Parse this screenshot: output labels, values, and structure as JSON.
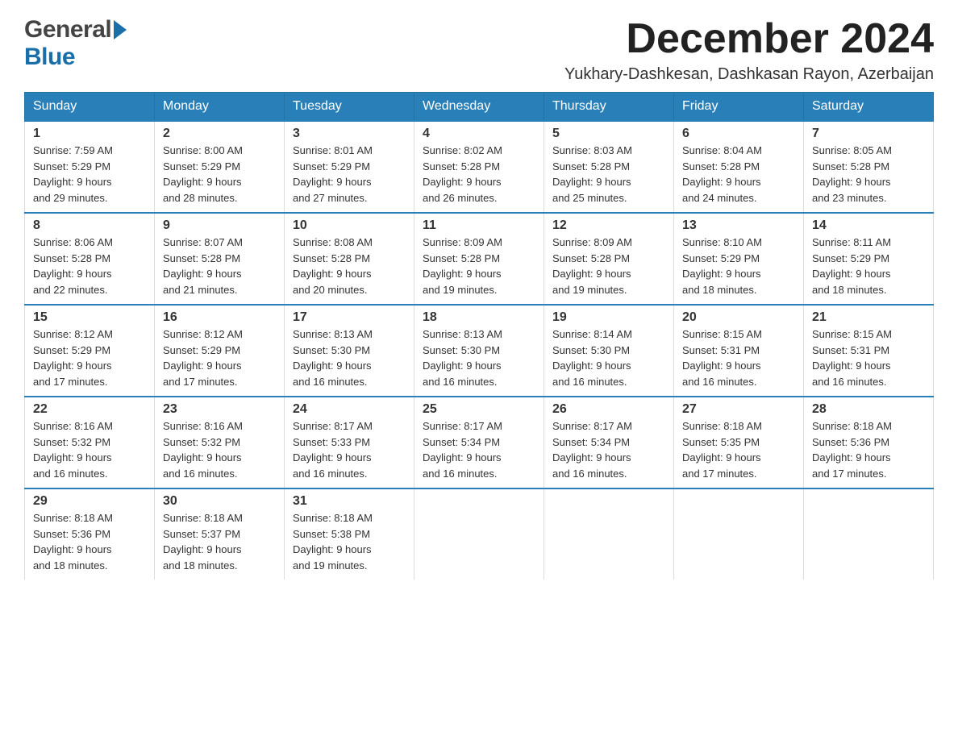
{
  "header": {
    "logo_general": "General",
    "logo_blue": "Blue",
    "month_title": "December 2024",
    "location": "Yukhary-Dashkesan, Dashkasan Rayon, Azerbaijan"
  },
  "weekdays": [
    "Sunday",
    "Monday",
    "Tuesday",
    "Wednesday",
    "Thursday",
    "Friday",
    "Saturday"
  ],
  "weeks": [
    [
      {
        "day": "1",
        "sunrise": "7:59 AM",
        "sunset": "5:29 PM",
        "daylight": "9 hours and 29 minutes."
      },
      {
        "day": "2",
        "sunrise": "8:00 AM",
        "sunset": "5:29 PM",
        "daylight": "9 hours and 28 minutes."
      },
      {
        "day": "3",
        "sunrise": "8:01 AM",
        "sunset": "5:29 PM",
        "daylight": "9 hours and 27 minutes."
      },
      {
        "day": "4",
        "sunrise": "8:02 AM",
        "sunset": "5:28 PM",
        "daylight": "9 hours and 26 minutes."
      },
      {
        "day": "5",
        "sunrise": "8:03 AM",
        "sunset": "5:28 PM",
        "daylight": "9 hours and 25 minutes."
      },
      {
        "day": "6",
        "sunrise": "8:04 AM",
        "sunset": "5:28 PM",
        "daylight": "9 hours and 24 minutes."
      },
      {
        "day": "7",
        "sunrise": "8:05 AM",
        "sunset": "5:28 PM",
        "daylight": "9 hours and 23 minutes."
      }
    ],
    [
      {
        "day": "8",
        "sunrise": "8:06 AM",
        "sunset": "5:28 PM",
        "daylight": "9 hours and 22 minutes."
      },
      {
        "day": "9",
        "sunrise": "8:07 AM",
        "sunset": "5:28 PM",
        "daylight": "9 hours and 21 minutes."
      },
      {
        "day": "10",
        "sunrise": "8:08 AM",
        "sunset": "5:28 PM",
        "daylight": "9 hours and 20 minutes."
      },
      {
        "day": "11",
        "sunrise": "8:09 AM",
        "sunset": "5:28 PM",
        "daylight": "9 hours and 19 minutes."
      },
      {
        "day": "12",
        "sunrise": "8:09 AM",
        "sunset": "5:28 PM",
        "daylight": "9 hours and 19 minutes."
      },
      {
        "day": "13",
        "sunrise": "8:10 AM",
        "sunset": "5:29 PM",
        "daylight": "9 hours and 18 minutes."
      },
      {
        "day": "14",
        "sunrise": "8:11 AM",
        "sunset": "5:29 PM",
        "daylight": "9 hours and 18 minutes."
      }
    ],
    [
      {
        "day": "15",
        "sunrise": "8:12 AM",
        "sunset": "5:29 PM",
        "daylight": "9 hours and 17 minutes."
      },
      {
        "day": "16",
        "sunrise": "8:12 AM",
        "sunset": "5:29 PM",
        "daylight": "9 hours and 17 minutes."
      },
      {
        "day": "17",
        "sunrise": "8:13 AM",
        "sunset": "5:30 PM",
        "daylight": "9 hours and 16 minutes."
      },
      {
        "day": "18",
        "sunrise": "8:13 AM",
        "sunset": "5:30 PM",
        "daylight": "9 hours and 16 minutes."
      },
      {
        "day": "19",
        "sunrise": "8:14 AM",
        "sunset": "5:30 PM",
        "daylight": "9 hours and 16 minutes."
      },
      {
        "day": "20",
        "sunrise": "8:15 AM",
        "sunset": "5:31 PM",
        "daylight": "9 hours and 16 minutes."
      },
      {
        "day": "21",
        "sunrise": "8:15 AM",
        "sunset": "5:31 PM",
        "daylight": "9 hours and 16 minutes."
      }
    ],
    [
      {
        "day": "22",
        "sunrise": "8:16 AM",
        "sunset": "5:32 PM",
        "daylight": "9 hours and 16 minutes."
      },
      {
        "day": "23",
        "sunrise": "8:16 AM",
        "sunset": "5:32 PM",
        "daylight": "9 hours and 16 minutes."
      },
      {
        "day": "24",
        "sunrise": "8:17 AM",
        "sunset": "5:33 PM",
        "daylight": "9 hours and 16 minutes."
      },
      {
        "day": "25",
        "sunrise": "8:17 AM",
        "sunset": "5:34 PM",
        "daylight": "9 hours and 16 minutes."
      },
      {
        "day": "26",
        "sunrise": "8:17 AM",
        "sunset": "5:34 PM",
        "daylight": "9 hours and 16 minutes."
      },
      {
        "day": "27",
        "sunrise": "8:18 AM",
        "sunset": "5:35 PM",
        "daylight": "9 hours and 17 minutes."
      },
      {
        "day": "28",
        "sunrise": "8:18 AM",
        "sunset": "5:36 PM",
        "daylight": "9 hours and 17 minutes."
      }
    ],
    [
      {
        "day": "29",
        "sunrise": "8:18 AM",
        "sunset": "5:36 PM",
        "daylight": "9 hours and 18 minutes."
      },
      {
        "day": "30",
        "sunrise": "8:18 AM",
        "sunset": "5:37 PM",
        "daylight": "9 hours and 18 minutes."
      },
      {
        "day": "31",
        "sunrise": "8:18 AM",
        "sunset": "5:38 PM",
        "daylight": "9 hours and 19 minutes."
      },
      null,
      null,
      null,
      null
    ]
  ],
  "labels": {
    "sunrise": "Sunrise:",
    "sunset": "Sunset:",
    "daylight": "Daylight:"
  }
}
